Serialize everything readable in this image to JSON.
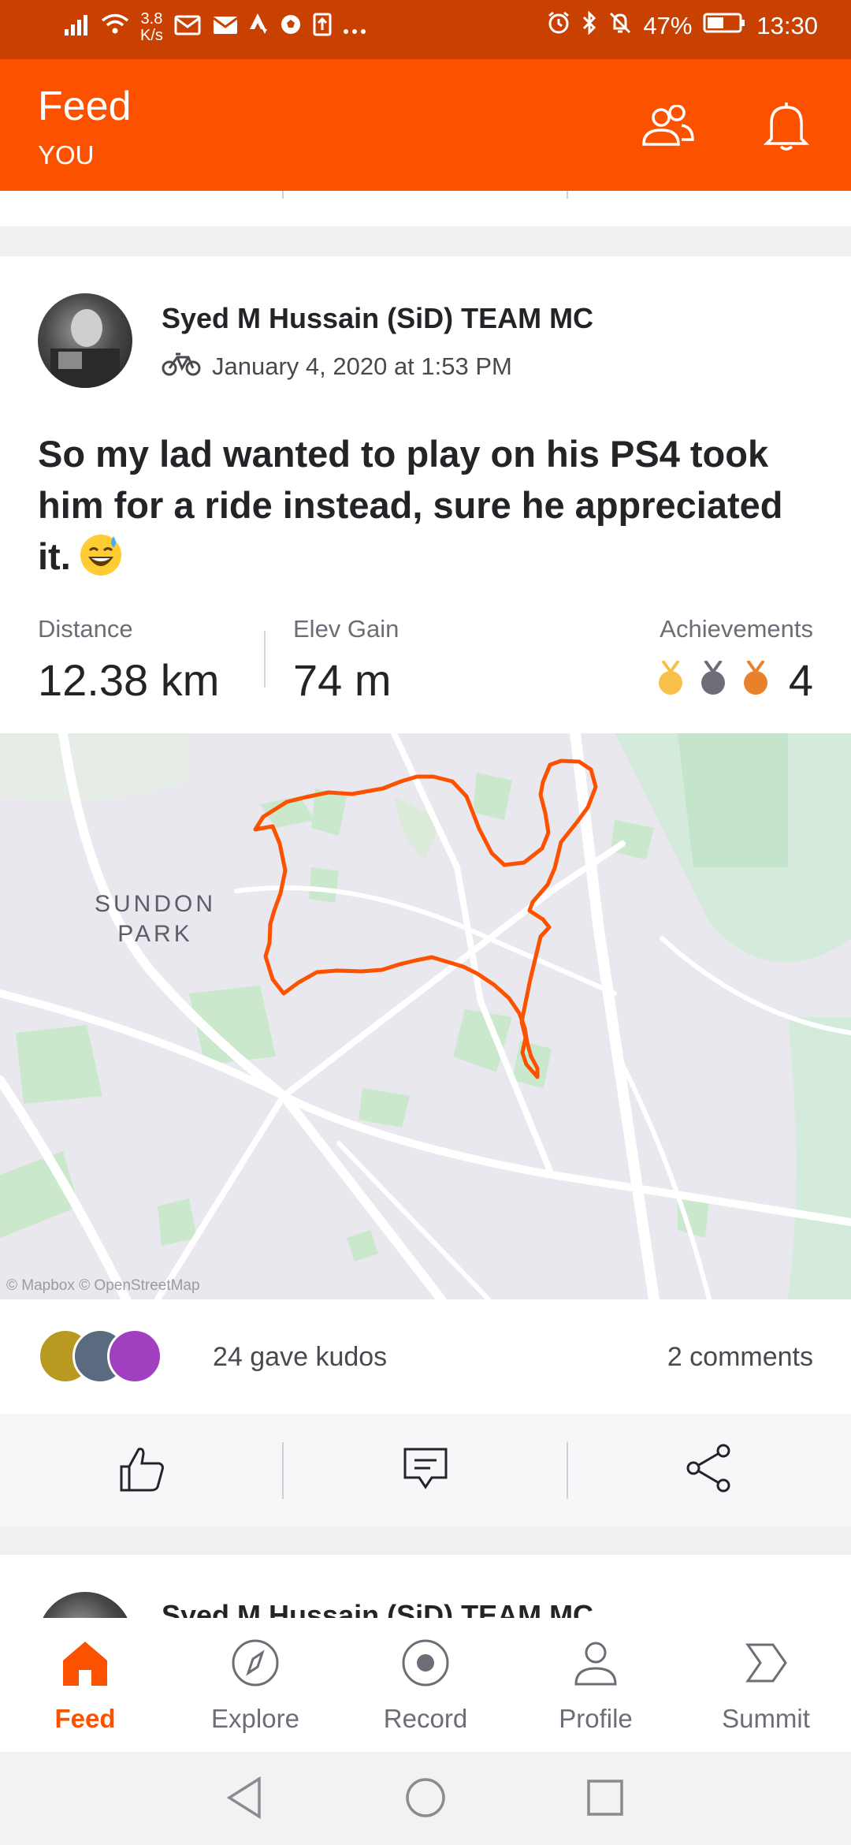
{
  "status_bar": {
    "net_speed_value": "3.8",
    "net_speed_unit": "K/s",
    "battery": "47%",
    "time": "13:30"
  },
  "header": {
    "title": "Feed",
    "subtitle": "YOU",
    "icons": [
      "group-icon",
      "bell-icon"
    ]
  },
  "activity": {
    "athlete": "Syed M Hussain (SiD) TEAM MC",
    "sport_icon": "bike-icon",
    "date": "January 4, 2020 at 1:53 PM",
    "title": "So my lad wanted to play on his PS4 took him for a ride instead, sure he appreciated it.",
    "emoji": "grinning-sweat-emoji",
    "stats": {
      "distance_label": "Distance",
      "distance_value": "12.38 km",
      "elev_label": "Elev Gain",
      "elev_value": "74 m",
      "achievements_label": "Achievements",
      "achievements_count": "4"
    },
    "medal_colors": [
      "#f6c04a",
      "#6d6d78",
      "#e8812a"
    ],
    "map": {
      "area_label_line1": "SUNDON",
      "area_label_line2": "PARK",
      "attribution": "© Mapbox © OpenStreetMap",
      "route_color": "#fc5200"
    },
    "kudos_text": "24 gave kudos",
    "comments_text": "2 comments"
  },
  "next_activity": {
    "athlete": "Syed M Hussain (SiD) TEAM MC"
  },
  "bottom_nav": {
    "items": [
      {
        "label": "Feed",
        "icon": "home-icon",
        "active": true
      },
      {
        "label": "Explore",
        "icon": "compass-icon",
        "active": false
      },
      {
        "label": "Record",
        "icon": "record-icon",
        "active": false
      },
      {
        "label": "Profile",
        "icon": "profile-icon",
        "active": false
      },
      {
        "label": "Summit",
        "icon": "summit-icon",
        "active": false
      }
    ]
  },
  "colors": {
    "brand": "#fc5200",
    "status_bar": "#c94100"
  }
}
